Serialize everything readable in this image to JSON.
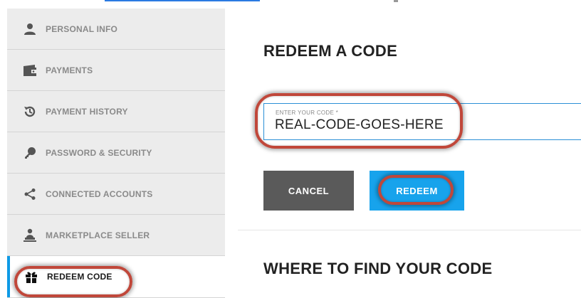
{
  "sidebar": {
    "items": [
      {
        "label": "PERSONAL INFO",
        "icon": "person-icon"
      },
      {
        "label": "PAYMENTS",
        "icon": "wallet-icon"
      },
      {
        "label": "PAYMENT HISTORY",
        "icon": "history-icon"
      },
      {
        "label": "PASSWORD & SECURITY",
        "icon": "key-icon"
      },
      {
        "label": "CONNECTED ACCOUNTS",
        "icon": "share-icon"
      },
      {
        "label": "MARKETPLACE SELLER",
        "icon": "seller-icon"
      },
      {
        "label": "REDEEM CODE",
        "icon": "gift-icon",
        "active": true
      }
    ]
  },
  "main": {
    "title": "REDEEM A CODE",
    "code_field": {
      "label": "ENTER YOUR CODE *",
      "value": "REAL-CODE-GOES-HERE"
    },
    "cancel_label": "CANCEL",
    "redeem_label": "REDEEM",
    "section_title": "WHERE TO FIND YOUR CODE"
  },
  "colors": {
    "accent": "#17a3ec",
    "cancel": "#5a5a5a",
    "highlight": "#c0473a",
    "sidebar_bg": "#ececec"
  }
}
